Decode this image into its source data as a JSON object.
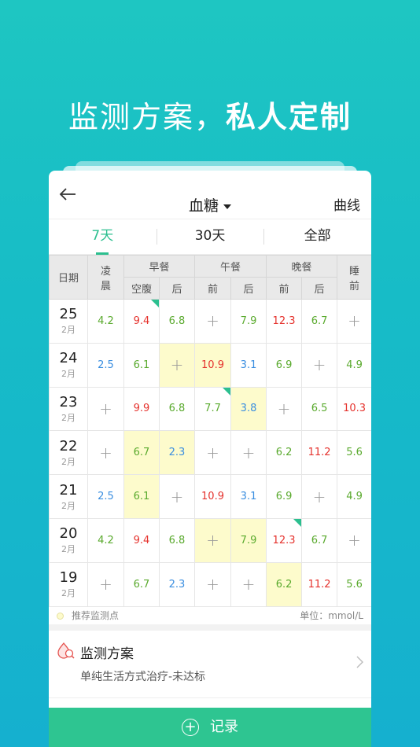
{
  "hero": {
    "part1": "监测方案，",
    "part2": "私人定制"
  },
  "topbar": {
    "title": "血糖",
    "right_label": "曲线"
  },
  "tabs": [
    {
      "label": "7天",
      "active": true
    },
    {
      "label": "30天",
      "active": false
    },
    {
      "label": "全部",
      "active": false
    }
  ],
  "table_header": {
    "date": "日期",
    "dawn": [
      "凌",
      "晨"
    ],
    "breakfast": "早餐",
    "lunch": "午餐",
    "dinner": "晚餐",
    "bedtime": [
      "睡",
      "前"
    ],
    "fasting": "空腹",
    "after": "后",
    "before": "前"
  },
  "rows": [
    {
      "day": "25",
      "month": "2月",
      "cells": [
        {
          "v": "4.2",
          "c": "green"
        },
        {
          "v": "9.4",
          "c": "red",
          "flag": true
        },
        {
          "v": "6.8",
          "c": "green"
        },
        {
          "v": "+",
          "c": "plus"
        },
        {
          "v": "7.9",
          "c": "green"
        },
        {
          "v": "12.3",
          "c": "red"
        },
        {
          "v": "6.7",
          "c": "green"
        },
        {
          "v": "+",
          "c": "plus"
        }
      ]
    },
    {
      "day": "24",
      "month": "2月",
      "cells": [
        {
          "v": "2.5",
          "c": "blue"
        },
        {
          "v": "6.1",
          "c": "green"
        },
        {
          "v": "+",
          "c": "plus",
          "hl": true
        },
        {
          "v": "10.9",
          "c": "red",
          "hl": true
        },
        {
          "v": "3.1",
          "c": "blue"
        },
        {
          "v": "6.9",
          "c": "green"
        },
        {
          "v": "+",
          "c": "plus"
        },
        {
          "v": "4.9",
          "c": "green"
        }
      ]
    },
    {
      "day": "23",
      "month": "2月",
      "cells": [
        {
          "v": "+",
          "c": "plus"
        },
        {
          "v": "9.9",
          "c": "red"
        },
        {
          "v": "6.8",
          "c": "green"
        },
        {
          "v": "7.7",
          "c": "green",
          "flag": true
        },
        {
          "v": "3.8",
          "c": "blue",
          "hl": true
        },
        {
          "v": "+",
          "c": "plus"
        },
        {
          "v": "6.5",
          "c": "green"
        },
        {
          "v": "10.3",
          "c": "red"
        }
      ]
    },
    {
      "day": "22",
      "month": "2月",
      "cells": [
        {
          "v": "+",
          "c": "plus"
        },
        {
          "v": "6.7",
          "c": "green",
          "hl": true
        },
        {
          "v": "2.3",
          "c": "blue",
          "hl": true
        },
        {
          "v": "+",
          "c": "plus"
        },
        {
          "v": "+",
          "c": "plus"
        },
        {
          "v": "6.2",
          "c": "green"
        },
        {
          "v": "11.2",
          "c": "red"
        },
        {
          "v": "5.6",
          "c": "green"
        }
      ]
    },
    {
      "day": "21",
      "month": "2月",
      "cells": [
        {
          "v": "2.5",
          "c": "blue"
        },
        {
          "v": "6.1",
          "c": "green",
          "hl": true
        },
        {
          "v": "+",
          "c": "plus"
        },
        {
          "v": "10.9",
          "c": "red"
        },
        {
          "v": "3.1",
          "c": "blue"
        },
        {
          "v": "6.9",
          "c": "green"
        },
        {
          "v": "+",
          "c": "plus"
        },
        {
          "v": "4.9",
          "c": "green"
        }
      ]
    },
    {
      "day": "20",
      "month": "2月",
      "cells": [
        {
          "v": "4.2",
          "c": "green"
        },
        {
          "v": "9.4",
          "c": "red"
        },
        {
          "v": "6.8",
          "c": "green"
        },
        {
          "v": "+",
          "c": "plus",
          "hl": true
        },
        {
          "v": "7.9",
          "c": "green",
          "hl": true
        },
        {
          "v": "12.3",
          "c": "red",
          "flag": true
        },
        {
          "v": "6.7",
          "c": "green"
        },
        {
          "v": "+",
          "c": "plus"
        }
      ]
    },
    {
      "day": "19",
      "month": "2月",
      "cells": [
        {
          "v": "+",
          "c": "plus"
        },
        {
          "v": "6.7",
          "c": "green"
        },
        {
          "v": "2.3",
          "c": "blue"
        },
        {
          "v": "+",
          "c": "plus"
        },
        {
          "v": "+",
          "c": "plus"
        },
        {
          "v": "6.2",
          "c": "green",
          "hl": true
        },
        {
          "v": "11.2",
          "c": "red"
        },
        {
          "v": "5.6",
          "c": "green"
        }
      ]
    }
  ],
  "legend": {
    "label": "推荐监测点",
    "unit": "单位：mmol/L"
  },
  "plan": {
    "title": "监测方案",
    "subtitle": "单纯生活方式治疗-未达标"
  },
  "record": {
    "label": "记录"
  },
  "colors": {
    "accent": "#2cbf8f",
    "high": "#e5322d",
    "normal": "#5aaa2e",
    "low": "#3a8ee0",
    "recommend": "#fdfbcc"
  }
}
